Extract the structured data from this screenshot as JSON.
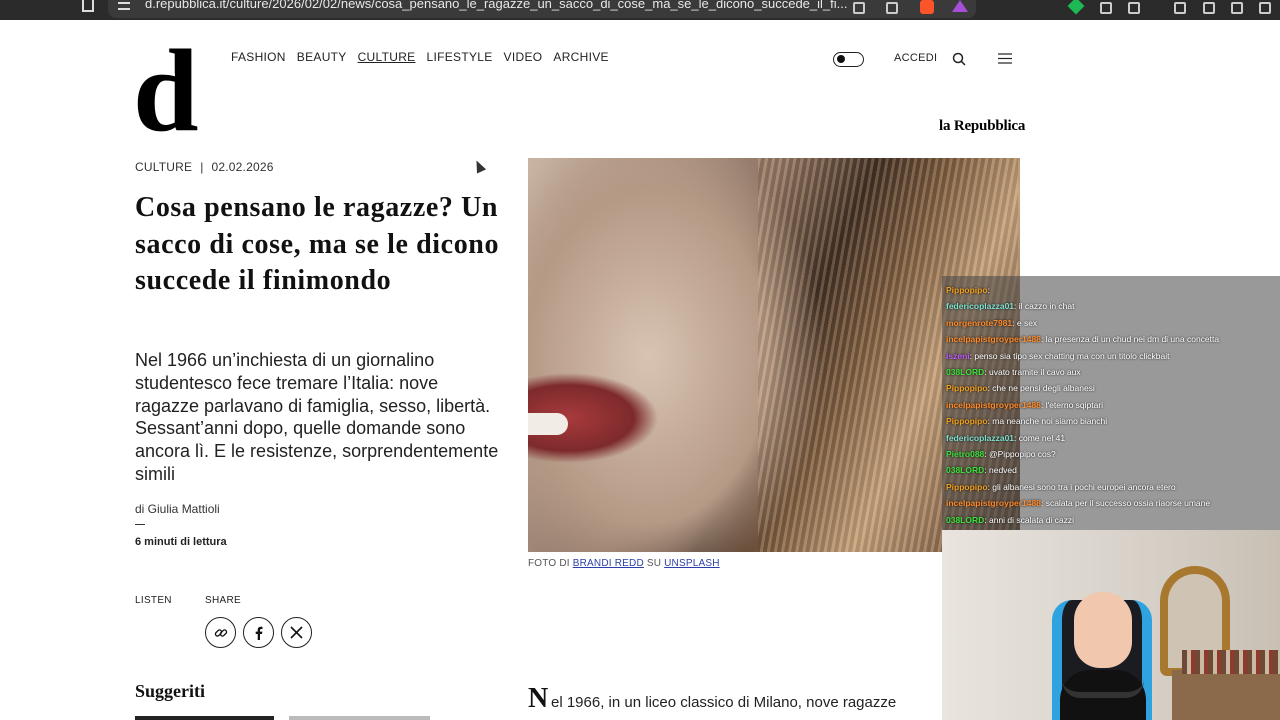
{
  "browser": {
    "url": "d.repubblica.it/culture/2026/02/02/news/cosa_pensano_le_ragazze_un_sacco_di_cose_ma_se_le_dicono_succede_il_fi..."
  },
  "site": {
    "logo": "d",
    "publisher": "la Repubblica",
    "nav": [
      "FASHION",
      "BEAUTY",
      "CULTURE",
      "LIFESTYLE",
      "VIDEO",
      "ARCHIVE"
    ],
    "active_nav": "CULTURE",
    "login": "ACCEDI"
  },
  "article": {
    "section": "CULTURE",
    "separator": "|",
    "date": "02.02.2026",
    "title": "Cosa pensano le ragazze? Un sacco di cose, ma se le dicono succede il finimondo",
    "subtitle": "Nel 1966 un’inchiesta di un giornalino studentesco fece tremare l’Italia: nove ragazze parlavano di famiglia, sesso, libertà. Sessant’anni dopo, quelle domande sono ancora lì. E le resistenze, sorprendentemente simili",
    "author": "di Giulia Mattioli",
    "read_time": "6 minuti di lettura",
    "listen_label": "LISTEN",
    "share_label": "SHARE",
    "caption": {
      "prefix": "FOTO DI",
      "photographer": "BRANDI REDD",
      "middle": "SU",
      "source": "UNSPLASH"
    },
    "body_dropcap": "N",
    "body_first_line": "el 1966, in un liceo classico di Milano, nove ragazze"
  },
  "suggested": {
    "heading": "Suggeriti"
  },
  "chat": {
    "messages": [
      {
        "user": "Pippopipo",
        "text": ": ",
        "color": "#f0a020"
      },
      {
        "user": "federicoplazza01",
        "text": ": il cazzo in chat",
        "color": "#7fe0d0"
      },
      {
        "user": "morgenrote7981",
        "text": ": e sex",
        "color": "#ff8a2a"
      },
      {
        "user": "incelpapistgroyper1488",
        "text": ": la presenza di un chud nei dm di una concetta",
        "color": "#ff8a2a"
      },
      {
        "user": "iszeni",
        "text": ": penso sia tipo sex chatting ma con un titolo clickbait",
        "color": "#c05cff"
      },
      {
        "user": "038LORD",
        "text": ": uvato tramite il cavo aux",
        "color": "#3ee03e"
      },
      {
        "user": "Pippopipo",
        "text": ": che ne pensi degli albanesi",
        "color": "#f0a020"
      },
      {
        "user": "incelpapistgroyper1488",
        "text": ": l'eterno sqiptari",
        "color": "#ff8a2a"
      },
      {
        "user": "Pippopipo",
        "text": ": ma neanche noi siamo bianchi",
        "color": "#f0a020"
      },
      {
        "user": "federicoplazza01",
        "text": ": come nel 41",
        "color": "#7fe0d0"
      },
      {
        "user": "Pietro088",
        "text": ": @Pippopipo cos?",
        "color": "#3ee03e"
      },
      {
        "user": "038LORD",
        "text": ": nedved",
        "color": "#3ee03e"
      },
      {
        "user": "Pippopipo",
        "text": ": gli albanesi sono tra i pochi europei ancora etero",
        "color": "#f0a020"
      },
      {
        "user": "incelpapistgroyper1488",
        "text": ": scalata per il successo ossia riaorse umane",
        "color": "#ff8a2a"
      },
      {
        "user": "038LORD",
        "text": ": anni di scalata di cazzi",
        "color": "#3ee03e"
      }
    ]
  },
  "icons": {
    "bookmark": "bookmark-icon",
    "site_settings": "tune-icon",
    "search": "search-icon",
    "menu": "hamburger-menu-icon",
    "theme_toggle": "dark-mode-toggle",
    "share_link": "link-icon",
    "share_facebook": "facebook-icon",
    "share_x": "x-icon"
  },
  "colors": {
    "link": "#2a3fa8",
    "text": "#111111"
  }
}
